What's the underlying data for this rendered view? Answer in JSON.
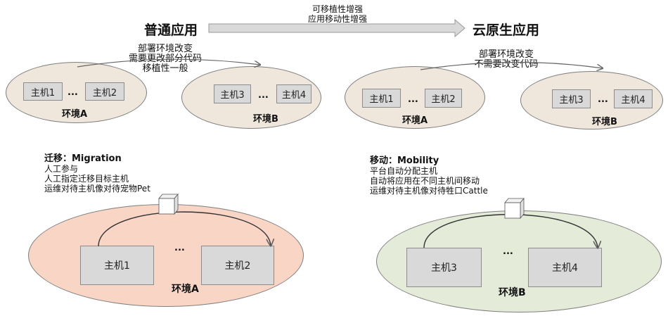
{
  "top": {
    "left_title": "普通应用",
    "right_title": "云原生应用",
    "arrow_line1": "可移植性增强",
    "arrow_line2": "应用移动性增强"
  },
  "left_top": {
    "note_line1": "部署环境改变",
    "note_line2": "需要更改部分代码",
    "note_line3": "移植性一般",
    "env_a": {
      "host1": "主机1",
      "host2": "主机2",
      "dots": "...",
      "label": "环境A"
    },
    "env_b": {
      "host3": "主机3",
      "host4": "主机4",
      "dots": "...",
      "label": "环境B"
    }
  },
  "right_top": {
    "note_line1": "部署环境改变",
    "note_line2": "不需要改变代码",
    "env_a": {
      "host1": "主机1",
      "host2": "主机2",
      "dots": "...",
      "label": "环境A"
    },
    "env_b": {
      "host3": "主机3",
      "host4": "主机4",
      "dots": "...",
      "label": "环境B"
    }
  },
  "migration": {
    "heading": "迁移：Migration",
    "line1": "人工参与",
    "line2": "人工指定迁移目标主机",
    "line3": "运维对待主机像对待宠物Pet",
    "cube_line1": "应用",
    "cube_line2": "服务",
    "host1": "主机1",
    "host2": "主机2",
    "dots": "...",
    "env_label": "环境A"
  },
  "mobility": {
    "heading": "移动：Mobility",
    "line1": "平台自动分配主机",
    "line2": "自动将应用在不同主机间移动",
    "line3": "运维对待主机像对待牲口Cattle",
    "cube_line1": "应用",
    "cube_line2": "服务",
    "host3": "主机3",
    "host4": "主机4",
    "dots": "...",
    "env_label": "环境B"
  },
  "colors": {
    "env_small_fill": "#efe6dc",
    "migration_fill": "#f8d5c5",
    "mobility_fill": "#e4ebd8",
    "host_fill": "#d9d9d9",
    "arrow_fill": "#d9d9d9"
  }
}
